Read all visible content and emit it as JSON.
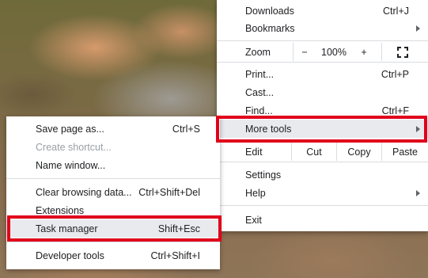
{
  "main_menu": {
    "downloads": {
      "label": "Downloads",
      "shortcut": "Ctrl+J"
    },
    "bookmarks": {
      "label": "Bookmarks"
    },
    "zoom": {
      "label": "Zoom",
      "minus": "−",
      "value": "100%",
      "plus": "+",
      "fullscreen_icon": "fullscreen-icon"
    },
    "print": {
      "label": "Print...",
      "shortcut": "Ctrl+P"
    },
    "cast": {
      "label": "Cast..."
    },
    "find": {
      "label": "Find...",
      "shortcut": "Ctrl+F"
    },
    "more_tools": {
      "label": "More tools"
    },
    "edit": {
      "label": "Edit",
      "cut": "Cut",
      "copy": "Copy",
      "paste": "Paste"
    },
    "settings": {
      "label": "Settings"
    },
    "help": {
      "label": "Help"
    },
    "exit": {
      "label": "Exit"
    }
  },
  "sub_menu": {
    "save_page": {
      "label": "Save page as...",
      "shortcut": "Ctrl+S"
    },
    "create_shortcut": {
      "label": "Create shortcut..."
    },
    "name_window": {
      "label": "Name window..."
    },
    "clear_browsing": {
      "label": "Clear browsing data...",
      "shortcut": "Ctrl+Shift+Del"
    },
    "extensions": {
      "label": "Extensions"
    },
    "task_manager": {
      "label": "Task manager",
      "shortcut": "Shift+Esc"
    },
    "developer_tools": {
      "label": "Developer tools",
      "shortcut": "Ctrl+Shift+I"
    }
  },
  "colors": {
    "highlight_box": "#e0001b",
    "hover_bg": "#e8eaed"
  }
}
